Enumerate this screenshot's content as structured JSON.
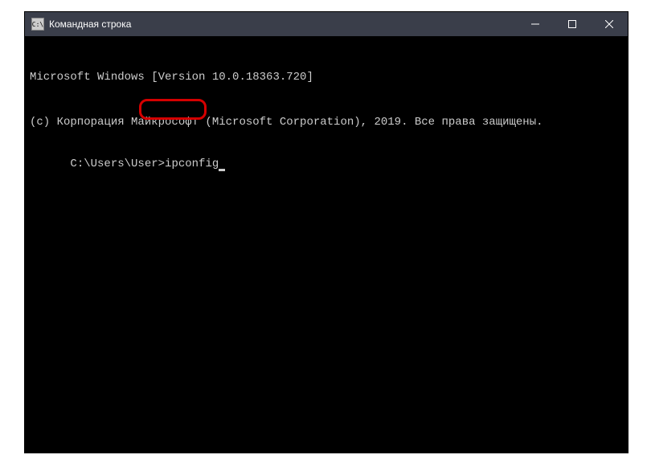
{
  "window": {
    "title": "Командная строка",
    "icon_label": "C:\\"
  },
  "terminal": {
    "line1": "Microsoft Windows [Version 10.0.18363.720]",
    "line2": "(c) Корпорация Майкрософт (Microsoft Corporation), 2019. Все права защищены.",
    "prompt": "C:\\Users\\User>",
    "command": "ipconfig"
  }
}
